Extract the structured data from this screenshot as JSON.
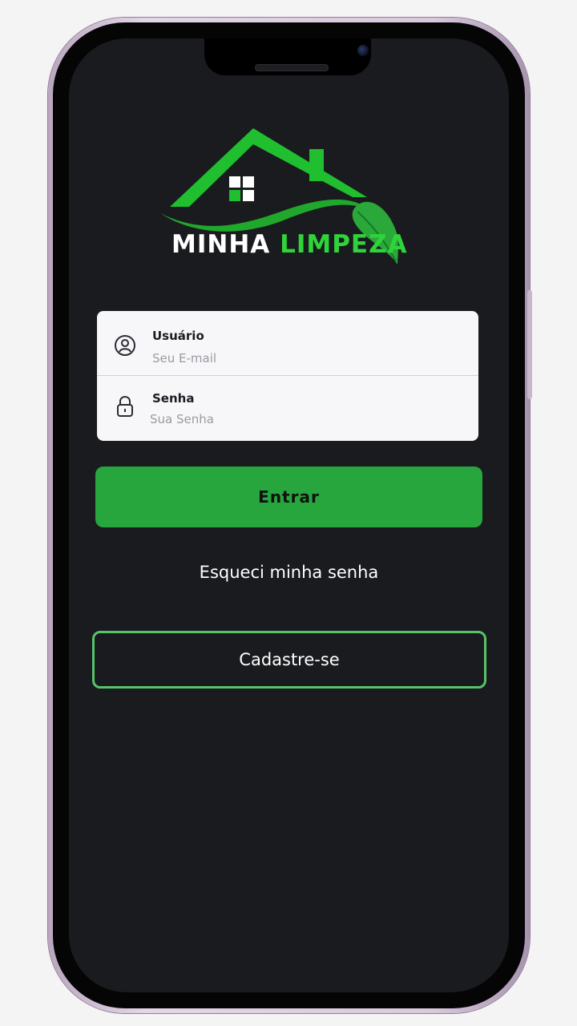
{
  "brand": {
    "name_part1": "MINHA",
    "name_part2": "LIMPEZA",
    "logo_icon": "house-leaf-logo-icon",
    "primary_color": "#26a63d",
    "accent_color": "#2fd43a"
  },
  "login_form": {
    "user_label": "Usuário",
    "user_placeholder": "Seu E-mail",
    "user_icon": "user-circle-icon",
    "password_label": "Senha",
    "password_placeholder": "Sua Senha",
    "password_icon": "lock-icon"
  },
  "actions": {
    "login_button": "Entrar",
    "forgot_password": "Esqueci minha senha",
    "signup_button": "Cadastre-se"
  },
  "colors": {
    "background": "#1a1b1e",
    "card": "#f7f7fa",
    "signup_border": "#55c46a"
  }
}
